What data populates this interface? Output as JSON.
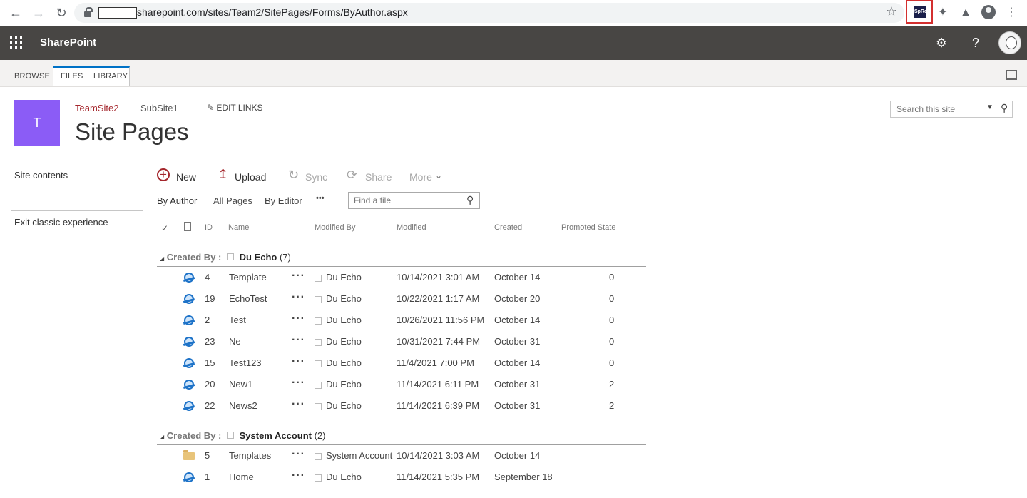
{
  "browser": {
    "url": "sharepoint.com/sites/Team2/SitePages/Forms/ByAuthor.aspx",
    "extension_label": "SpRc"
  },
  "suite": {
    "brand": "SharePoint"
  },
  "ribbon": {
    "tabs": [
      "BROWSE",
      "FILES",
      "LIBRARY"
    ]
  },
  "site": {
    "logo_letter": "T",
    "top_links": [
      "TeamSite2",
      "SubSite1"
    ],
    "edit_links": "EDIT LINKS",
    "title": "Site Pages",
    "search_placeholder": "Search this site"
  },
  "quicklaunch": {
    "site_contents": "Site contents",
    "exit_classic": "Exit classic experience"
  },
  "commands": {
    "new": "New",
    "upload": "Upload",
    "sync": "Sync",
    "share": "Share",
    "more": "More"
  },
  "views": {
    "by_author": "By Author",
    "all_pages": "All Pages",
    "by_editor": "By Editor",
    "ellipsis": "•••",
    "find_placeholder": "Find a file"
  },
  "columns": {
    "id": "ID",
    "name": "Name",
    "modified_by": "Modified By",
    "modified": "Modified",
    "created": "Created",
    "promoted": "Promoted State"
  },
  "groups": [
    {
      "label": "Created By :",
      "name": "Du Echo",
      "count": "(7)",
      "rows": [
        {
          "id": "4",
          "name": "Template",
          "modified_by": "Du Echo",
          "modified": "10/14/2021 3:01 AM",
          "created": "October 14",
          "promoted": "0",
          "icon": "page-icon"
        },
        {
          "id": "19",
          "name": "EchoTest",
          "modified_by": "Du Echo",
          "modified": "10/22/2021 1:17 AM",
          "created": "October 20",
          "promoted": "0",
          "icon": "page-icon"
        },
        {
          "id": "2",
          "name": "Test",
          "modified_by": "Du Echo",
          "modified": "10/26/2021 11:56 PM",
          "created": "October 14",
          "promoted": "0",
          "icon": "page-icon"
        },
        {
          "id": "23",
          "name": "Ne",
          "modified_by": "Du Echo",
          "modified": "10/31/2021 7:44 PM",
          "created": "October 31",
          "promoted": "0",
          "icon": "page-icon"
        },
        {
          "id": "15",
          "name": "Test123",
          "modified_by": "Du Echo",
          "modified": "11/4/2021 7:00 PM",
          "created": "October 14",
          "promoted": "0",
          "icon": "page-icon"
        },
        {
          "id": "20",
          "name": "New1",
          "modified_by": "Du Echo",
          "modified": "11/14/2021 6:11 PM",
          "created": "October 31",
          "promoted": "2",
          "icon": "page-icon"
        },
        {
          "id": "22",
          "name": "News2",
          "modified_by": "Du Echo",
          "modified": "11/14/2021 6:39 PM",
          "created": "October 31",
          "promoted": "2",
          "icon": "page-icon"
        }
      ]
    },
    {
      "label": "Created By :",
      "name": "System Account",
      "count": "(2)",
      "rows": [
        {
          "id": "5",
          "name": "Templates",
          "modified_by": "System Account",
          "modified": "10/14/2021 3:03 AM",
          "created": "October 14",
          "promoted": "",
          "icon": "folder-icon"
        },
        {
          "id": "1",
          "name": "Home",
          "modified_by": "Du Echo",
          "modified": "11/14/2021 5:35 PM",
          "created": "September 18",
          "promoted": "",
          "icon": "page-icon"
        }
      ]
    }
  ]
}
